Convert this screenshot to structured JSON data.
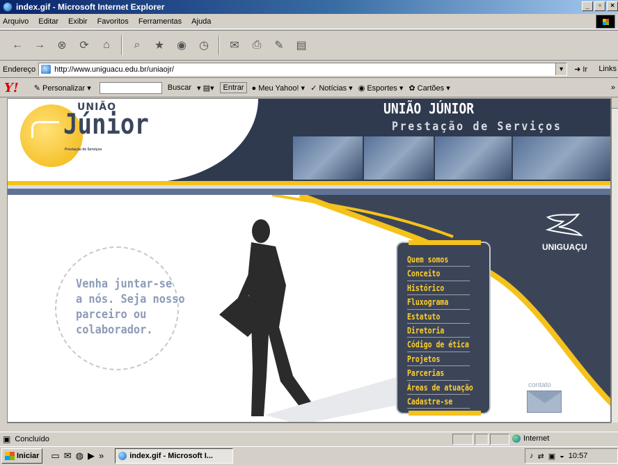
{
  "window": {
    "title": "index.gif - Microsoft Internet Explorer"
  },
  "menu": [
    "Arquivo",
    "Editar",
    "Exibir",
    "Favoritos",
    "Ferramentas",
    "Ajuda"
  ],
  "address": {
    "label": "Endereço",
    "url": "http://www.uniguacu.edu.br/uniaojr/",
    "go": "Ir",
    "links": "Links"
  },
  "yahoo": {
    "personalize": "Personalizar",
    "search": "Buscar",
    "entrar": "Entrar",
    "items": [
      "Meu Yahoo!",
      "Notícias",
      "Esportes",
      "Cartões"
    ]
  },
  "site": {
    "logo_top": "UNIÃO",
    "logo_main": "Júnior",
    "logo_sub": "Prestação de Serviços",
    "header_title": "UNIÃO JÚNIOR",
    "header_subtitle": "Prestação de Serviços",
    "slogan": [
      "Venha juntar-se",
      "a nós. Seja nosso",
      "parceiro ou",
      "colaborador."
    ],
    "menu": [
      "Quem somos",
      "Conceito",
      "Histórico",
      "Fluxograma",
      "Estatuto",
      "Diretoria",
      "Código de ética",
      "Projetos",
      "Parcerias",
      "Áreas de atuação",
      "Cadastre-se"
    ],
    "brand": "UNIGUAÇU",
    "contact": "contato"
  },
  "status": {
    "text": "Concluído",
    "zone": "Internet"
  },
  "taskbar": {
    "start": "Iniciar",
    "task": "index.gif - Microsoft I...",
    "clock": "10:57"
  },
  "colors": {
    "accent_yellow": "#f5c21b",
    "dark_slate": "#3c4558",
    "titlebar": "#0a246a"
  }
}
